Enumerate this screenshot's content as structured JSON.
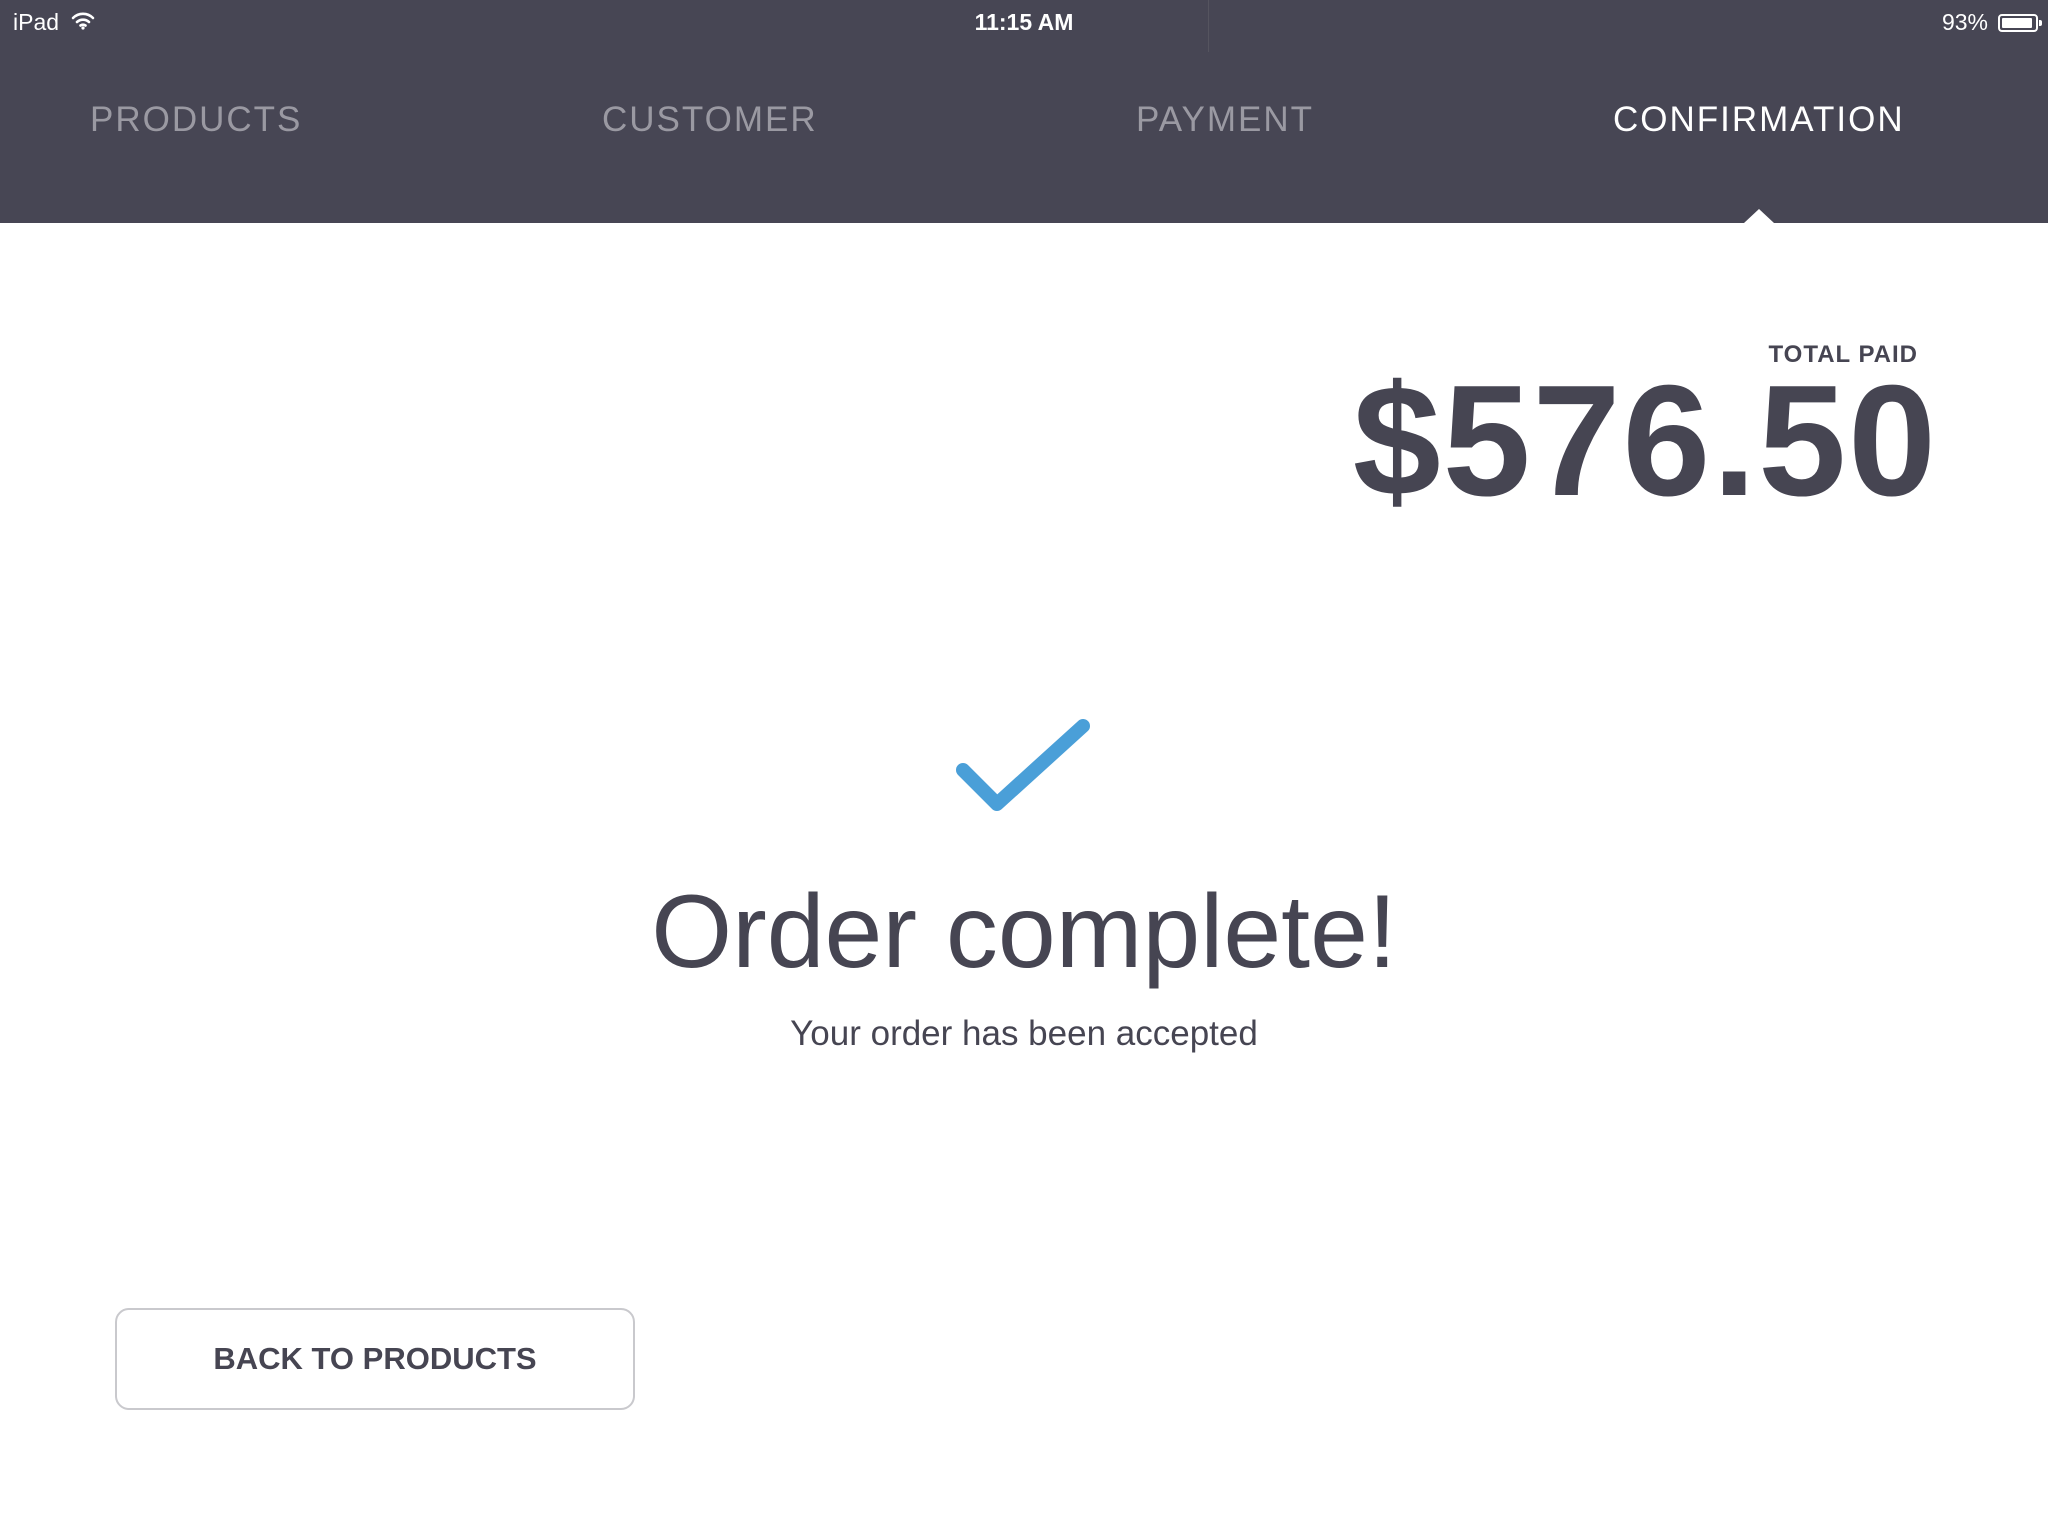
{
  "status_bar": {
    "device": "iPad",
    "time": "11:15 AM",
    "battery_text": "93%",
    "battery_level": 0.93
  },
  "tabs": [
    {
      "label": "PRODUCTS",
      "active": false
    },
    {
      "label": "CUSTOMER",
      "active": false
    },
    {
      "label": "PAYMENT",
      "active": false
    },
    {
      "label": "CONFIRMATION",
      "active": true
    }
  ],
  "summary": {
    "total_label": "TOTAL PAID",
    "total_amount": "$576.50"
  },
  "confirmation": {
    "icon": "checkmark-icon",
    "title": "Order complete!",
    "subtitle": "Your order has been accepted"
  },
  "actions": {
    "back_label": "BACK TO PRODUCTS"
  },
  "colors": {
    "header_bg": "#474654",
    "accent": "#4a9fd8",
    "text": "#464552"
  }
}
